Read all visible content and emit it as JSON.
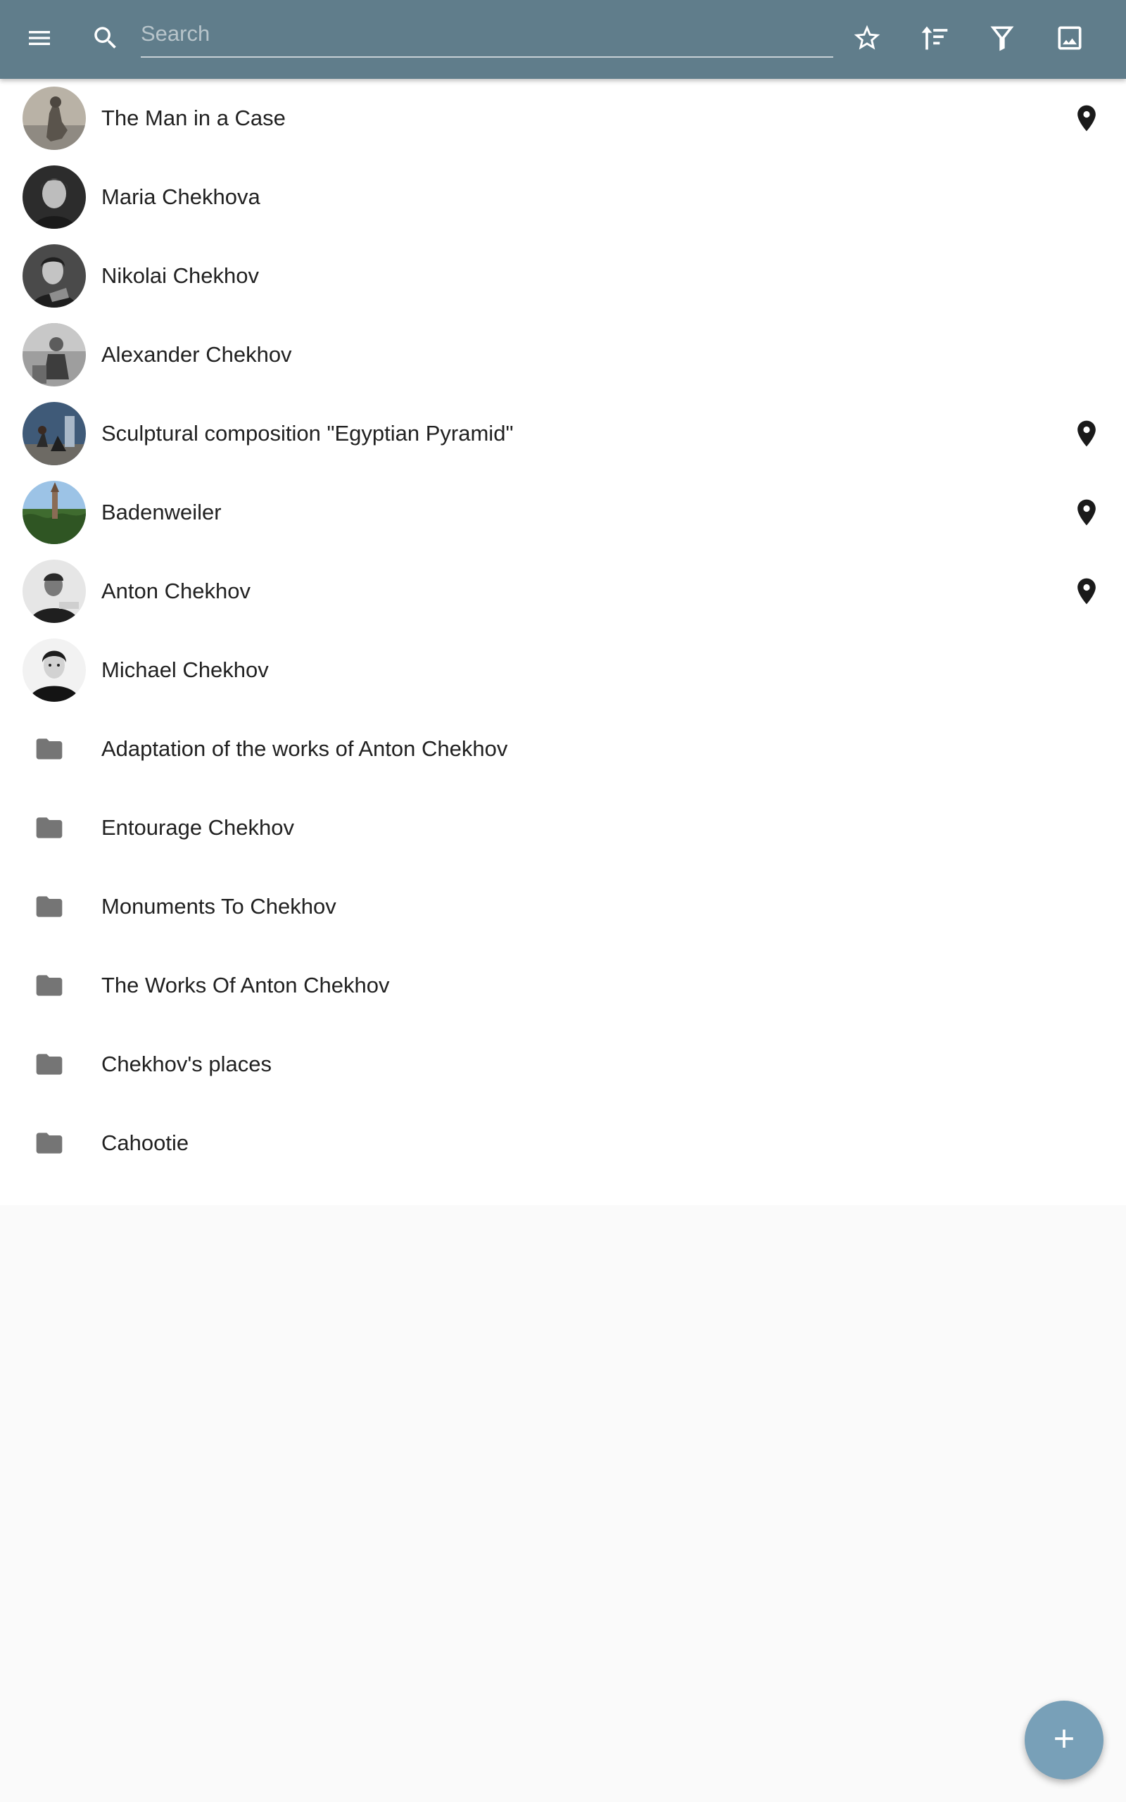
{
  "toolbar": {
    "menu_icon": "menu-icon",
    "search_icon": "search-icon",
    "search_placeholder": "Search",
    "search_value": "",
    "actions": [
      "star-outline-icon",
      "sort-icon",
      "filter-icon",
      "image-icon"
    ]
  },
  "colors": {
    "appbar": "#607d8b",
    "fab": "#78a0b8",
    "list_bg": "#ffffff",
    "page_bg": "#fafafa",
    "folder_icon": "#757575"
  },
  "items": [
    {
      "label": "The Man in a Case",
      "kind": "photo",
      "has_location": true,
      "icon": "location-pin-icon"
    },
    {
      "label": "Maria Chekhova",
      "kind": "photo",
      "has_location": false
    },
    {
      "label": "Nikolai Chekhov",
      "kind": "photo",
      "has_location": false
    },
    {
      "label": "Alexander Chekhov",
      "kind": "photo",
      "has_location": false
    },
    {
      "label": "Sculptural composition \"Egyptian Pyramid\"",
      "kind": "photo",
      "has_location": true,
      "icon": "location-pin-icon"
    },
    {
      "label": "Badenweiler",
      "kind": "photo",
      "has_location": true,
      "icon": "location-pin-icon"
    },
    {
      "label": "Anton Chekhov",
      "kind": "photo",
      "has_location": true,
      "icon": "location-pin-icon"
    },
    {
      "label": "Michael Chekhov",
      "kind": "photo",
      "has_location": false
    },
    {
      "label": "Adaptation of the works of Anton Chekhov",
      "kind": "folder",
      "icon": "folder-icon"
    },
    {
      "label": "Entourage Chekhov",
      "kind": "folder",
      "icon": "folder-icon"
    },
    {
      "label": "Monuments To Chekhov",
      "kind": "folder",
      "icon": "folder-icon"
    },
    {
      "label": "The Works Of Anton Chekhov",
      "kind": "folder",
      "icon": "folder-icon"
    },
    {
      "label": "Chekhov's places",
      "kind": "folder",
      "icon": "folder-icon"
    },
    {
      "label": "Cahootie",
      "kind": "folder",
      "icon": "folder-icon"
    }
  ],
  "fab": {
    "icon": "plus-icon"
  }
}
